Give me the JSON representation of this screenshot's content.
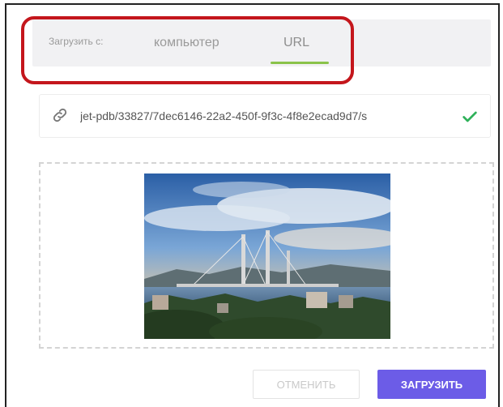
{
  "tabs": {
    "prefix_label": "Загрузить с:",
    "computer_label": "компьютер",
    "url_label": "URL"
  },
  "url_field": {
    "value": "jet-pdb/33827/7dec6146-22a2-450f-9f3c-4f8e2ecad9d7/s"
  },
  "preview": {
    "alt": "city bridge photo"
  },
  "actions": {
    "cancel_label": "ОТМЕНИТЬ",
    "upload_label": "ЗАГРУЗИТЬ"
  },
  "colors": {
    "accent": "#6c5ce7",
    "active_tab_underline": "#8bc34a",
    "valid_check": "#2fb15a",
    "highlight": "#c4161c"
  },
  "icons": [
    "link-icon",
    "check-icon"
  ]
}
